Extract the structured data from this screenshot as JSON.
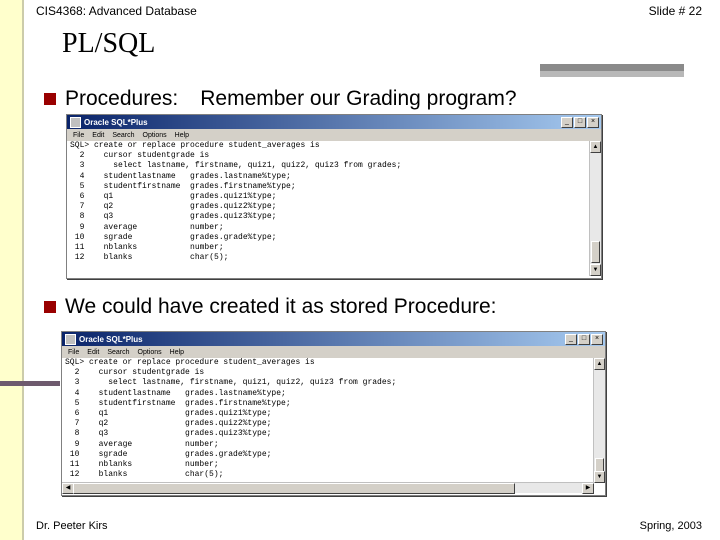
{
  "header": {
    "course": "CIS4368: Advanced Database",
    "slide": "Slide # 22"
  },
  "title": "PL/SQL",
  "bullets": [
    {
      "lead": "Procedures:",
      "text": "Remember our Grading program?"
    },
    {
      "lead": "",
      "text": "We could have created it as stored Procedure:"
    }
  ],
  "window1": {
    "title": "Oracle SQL*Plus",
    "menu": [
      "File",
      "Edit",
      "Search",
      "Options",
      "Help"
    ],
    "code": "SQL> create or replace procedure student_averages is\n  2    cursor studentgrade is\n  3      select lastname, firstname, quiz1, quiz2, quiz3 from grades;\n  4    studentlastname   grades.lastname%type;\n  5    studentfirstname  grades.firstname%type;\n  6    q1                grades.quiz1%type;\n  7    q2                grades.quiz2%type;\n  8    q3                grades.quiz3%type;\n  9    average           number;\n 10    sgrade            grades.grade%type;\n 11    nblanks           number;\n 12    blanks            char(5);"
  },
  "window2": {
    "title": "Oracle SQL*Plus",
    "menu": [
      "File",
      "Edit",
      "Search",
      "Options",
      "Help"
    ],
    "code": "SQL> create or replace procedure student_averages is\n  2    cursor studentgrade is\n  3      select lastname, firstname, quiz1, quiz2, quiz3 from grades;\n  4    studentlastname   grades.lastname%type;\n  5    studentfirstname  grades.firstname%type;\n  6    q1                grades.quiz1%type;\n  7    q2                grades.quiz2%type;\n  8    q3                grades.quiz3%type;\n  9    average           number;\n 10    sgrade            grades.grade%type;\n 11    nblanks           number;\n 12    blanks            char(5);"
  },
  "footer": {
    "author": "Dr. Peeter Kirs",
    "term": "Spring, 2003"
  },
  "colors": {
    "bullet": "#990000",
    "rail": "#ffffcc",
    "titlebar": "#0a246a"
  }
}
